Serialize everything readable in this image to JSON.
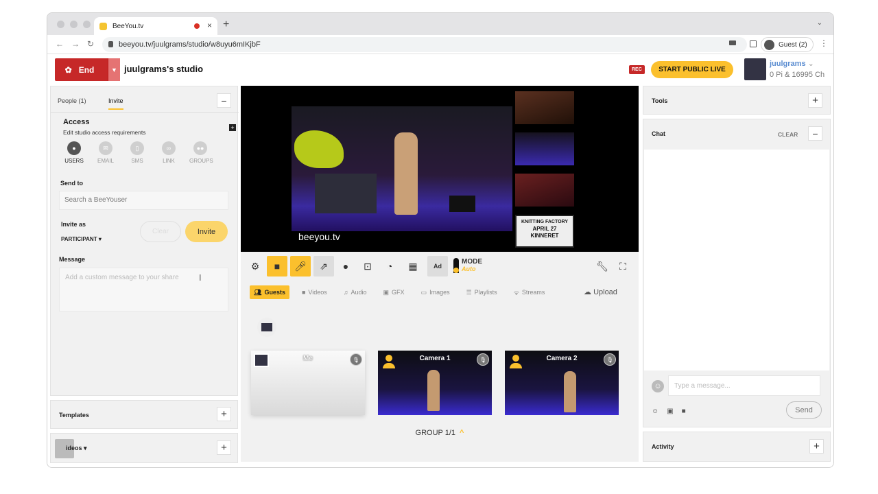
{
  "browser": {
    "tab_title": "BeeYou.tv",
    "tab_close": "×",
    "new_tab": "+",
    "url": "beeyou.tv/juulgrams/studio/w8uyu6mIKjbF",
    "profile": "Guest (2)"
  },
  "header": {
    "end_label": "End",
    "studio_name": "juulgrams's studio",
    "rec_badge": "REC",
    "go_live": "START PUBLIC LIVE",
    "username": "juulgrams",
    "currency": "0 Pi & 16995 Ch"
  },
  "left_panel": {
    "tabs": [
      "People (1)",
      "Invite"
    ],
    "access_title": "Access",
    "access_subtitle": "Edit studio access requirements",
    "access_options": [
      {
        "label": "USERS",
        "icon": "user-icon"
      },
      {
        "label": "EMAIL",
        "icon": "email-icon"
      },
      {
        "label": "SMS",
        "icon": "phone-icon"
      },
      {
        "label": "LINK",
        "icon": "link-icon"
      },
      {
        "label": "GROUPS",
        "icon": "groups-icon"
      }
    ],
    "send_to_label": "Send to",
    "send_to_placeholder": "Search a BeeYouser",
    "invite_as_label": "Invite as",
    "invite_as_value": "PARTICIPANT",
    "ghost_button": "Clear",
    "invite_button": "Invite",
    "message_label": "Message",
    "message_placeholder": "Add a custom message to your share",
    "templates_label": "Templates",
    "videos_label": "ideos"
  },
  "stage": {
    "logo_text": "beeyou.tv",
    "sign_text": [
      "KNITTING FACTORY",
      "APRIL 27",
      "KINNERET"
    ]
  },
  "controls": {
    "mode_label": "MODE",
    "mode_sub": "Auto"
  },
  "library": {
    "tabs": [
      "Guests",
      "Videos",
      "Audio",
      "GFX",
      "Images",
      "Playlists",
      "Streams"
    ],
    "upload": "Upload",
    "cameras": [
      "Me",
      "Camera 1",
      "Camera 2"
    ],
    "group_label": "GROUP 1/1"
  },
  "right_panel": {
    "tools_label": "Tools",
    "chat_label": "Chat",
    "clear_label": "CLEAR",
    "chat_placeholder": "Type a message...",
    "send_label": "Send",
    "activity_label": "Activity"
  },
  "colors": {
    "accent": "#fbc02d",
    "end": "#c62828",
    "link": "#5b8dd1"
  }
}
